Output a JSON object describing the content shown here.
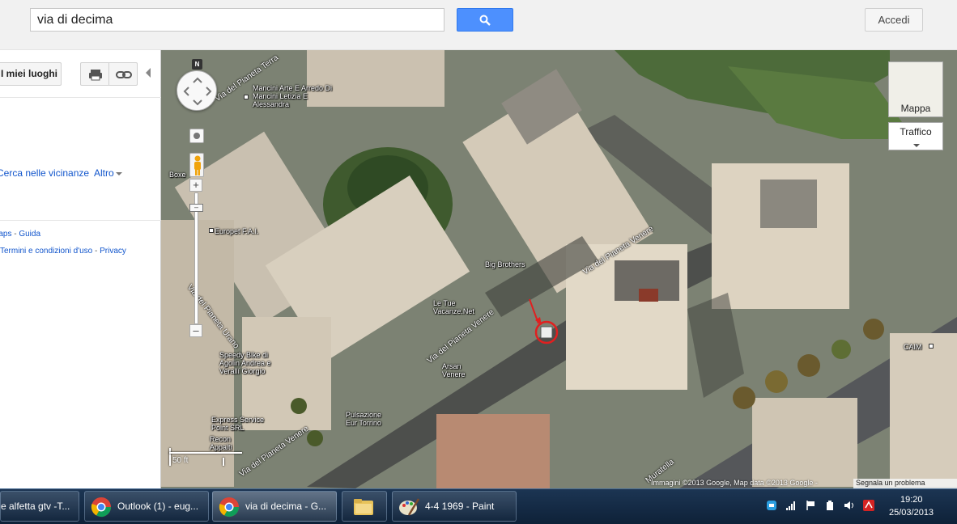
{
  "search": {
    "value": "via di decima"
  },
  "topbar": {
    "sign_in_label": "Accedi"
  },
  "left_panel": {
    "my_places_label": "I miei luoghi",
    "nearby_label": "Cerca nelle vicinanze",
    "more_label": "Altro",
    "footer_line1": [
      "Maps",
      "Guida"
    ],
    "footer_line2": [
      "Termini e condizioni d'uso",
      "Privacy"
    ]
  },
  "map": {
    "compass_label": "N",
    "map_type_label": "Mappa",
    "traffic_label": "Traffico",
    "scale_label": "50 ft",
    "attribution": "Immagini ©2013 Google, Map data ©2013 Google -",
    "report_problem": "Segnala un problema",
    "places": [
      "Mancini Arte E Arredo Di Mancini Letizia E Alessandra",
      "Boxe",
      "Europet F.A.I.",
      "Big Brothers",
      "Le Tue Vacanze.Net",
      "Arsan Venere",
      "Speedy Bike di Agolin Andrea e Verallí Giorgio",
      "Pulsazione Eur Torrino",
      "Express Service Point SRL",
      "Recon Appalti",
      "CAIM"
    ],
    "roads": [
      "Via del Pianeta Terra",
      "Via del Pianeta Urano",
      "Via del Pianeta Venere",
      "Via del Pianeta Venere",
      "Via del Pianeta Venere",
      "Muratella"
    ]
  },
  "taskbar": {
    "tasks": [
      "e alfetta gtv -T...",
      "Outlook (1) - eug...",
      "via di decima - G...",
      "",
      "4-4 1969 - Paint"
    ],
    "clock_time": "19:20",
    "clock_date": "25/03/2013"
  },
  "colors": {
    "search_button": "#4d90fe",
    "link": "#1155cc",
    "taskbar": "#1c3553",
    "marker_circle": "#e02020"
  }
}
